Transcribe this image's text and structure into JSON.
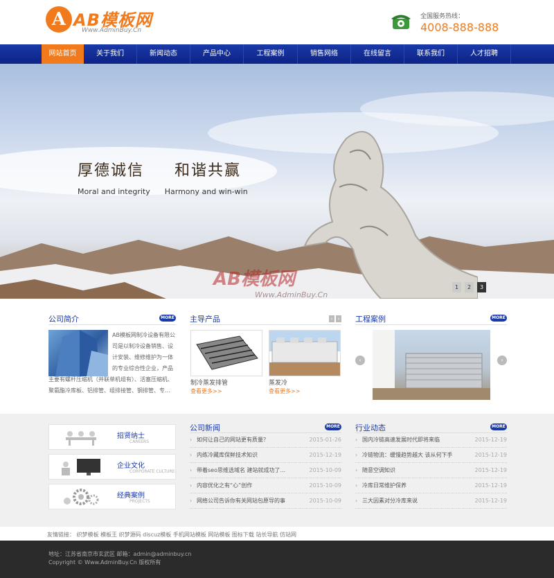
{
  "header": {
    "logo_mark": "A",
    "logo_text": "AB模板网",
    "logo_url": "Www.AdminBuy.Cn",
    "hotline_label": "全国服务热线：",
    "hotline_number": "4008-888-888"
  },
  "nav": {
    "items": [
      "网站首页",
      "关于我们",
      "新闻动态",
      "产品中心",
      "工程案例",
      "销售网络",
      "在线留言",
      "联系我们",
      "人才招聘"
    ],
    "active_index": 0
  },
  "banner": {
    "slogan_cn_1": "厚德诚信",
    "slogan_cn_2": "和谐共赢",
    "slogan_en_1": "Moral and integrity",
    "slogan_en_2": "Harmony and win-win",
    "watermark": "AB模板网",
    "watermark_url": "Www.AdminBuy.Cn",
    "slides": [
      "1",
      "2",
      "3"
    ],
    "active_slide": 3
  },
  "intro": {
    "title": "公司简介",
    "more": "MORE",
    "text": "AB模板网制冷设备有限公司是以制冷设备销售、设计安装、维修维护为一体的专业综合性企业，产品主要有螺杆压缩机（并联单机组有）、活塞压缩机、聚氨酯冷库板、铝排管、组排接管、钢排管、专..."
  },
  "products": {
    "title": "主导产品",
    "items": [
      {
        "name": "制冷蒸发排管",
        "more": "查看更多>>"
      },
      {
        "name": "蒸发冷",
        "more": "查看更多>>"
      }
    ]
  },
  "cases": {
    "title": "工程案例",
    "more": "MORE",
    "prev": "‹",
    "next": "›"
  },
  "side_cards": [
    {
      "cn": "招贤纳士",
      "en": "CAREERS"
    },
    {
      "cn": "企业文化",
      "en": "CORPORATE CULTURE"
    },
    {
      "cn": "经典案例",
      "en": "PROJECTS"
    }
  ],
  "company_news": {
    "title": "公司新闻",
    "more": "MORE",
    "items": [
      {
        "title": "如何让自己的网站更有质量？",
        "date": "2015-01-26"
      },
      {
        "title": "内练冷藏库保鲜技术知识",
        "date": "2015-12-19"
      },
      {
        "title": "带着seo思维选域名 建站就成功了...",
        "date": "2015-10-09"
      },
      {
        "title": "内容优化之有“心”创作",
        "date": "2015-10-09"
      },
      {
        "title": "网络公司告诉你有关网站包原导的事",
        "date": "2015-10-09"
      }
    ]
  },
  "industry_news": {
    "title": "行业动态",
    "more": "MORE",
    "items": [
      {
        "title": "国内冷链高速发展时代即将来临",
        "date": "2015-12-19"
      },
      {
        "title": "冷链物流：缓慢趋势越大 该从何下手",
        "date": "2015-12-19"
      },
      {
        "title": "随意空调知识",
        "date": "2015-12-19"
      },
      {
        "title": "冷库日常维护保养",
        "date": "2015-12-19"
      },
      {
        "title": "三大因素对分冷库来说",
        "date": "2015-12-19"
      }
    ]
  },
  "links": "友情链接： 织梦模板 模板王 织梦源码 discuz模板 手机网站模板 网站模板 图标下载 站长导航 仿站网",
  "footer": {
    "address": "地址：江苏省南京市玄武区  邮箱：admin@adminbuy.cn",
    "copyright": "Copyright © Www.AdminBuy.Cn 版权所有"
  },
  "colors": {
    "brand_orange": "#f07a1c",
    "nav_blue": "#1a3aa8",
    "footer_dark": "#2b2b2b"
  }
}
